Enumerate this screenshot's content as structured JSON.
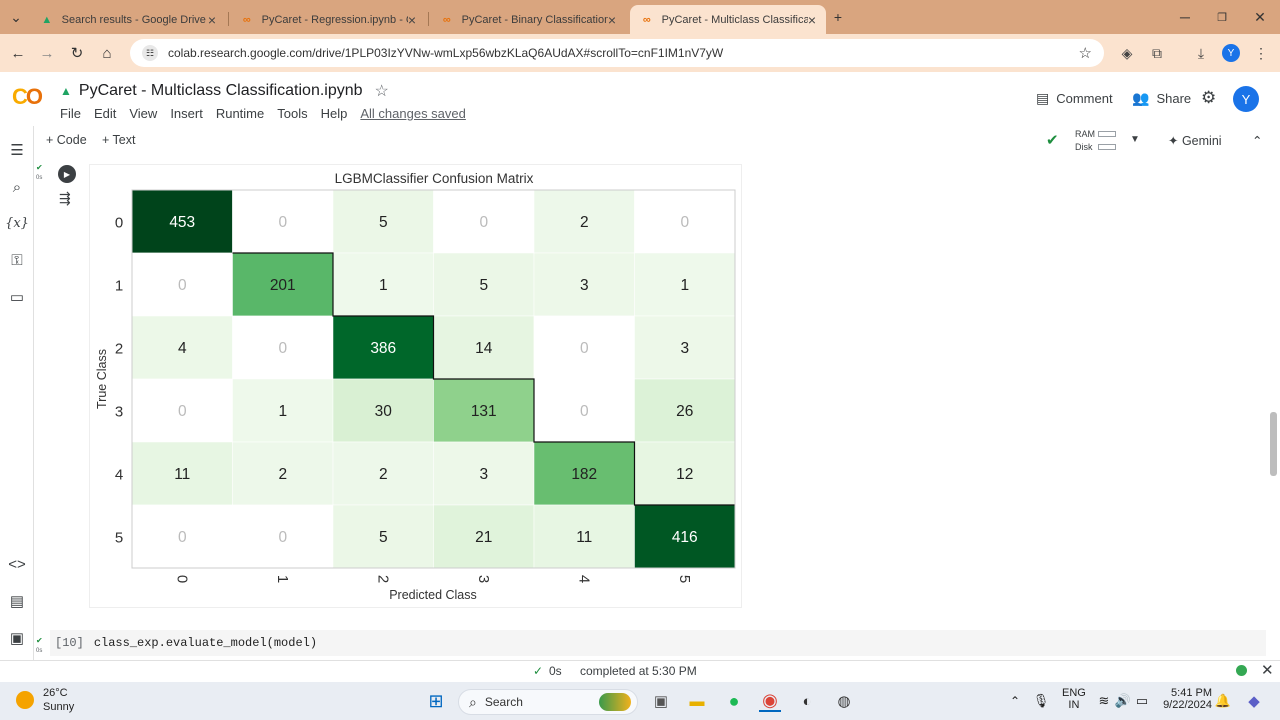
{
  "browser": {
    "tabs": [
      {
        "title": "Search results - Google Drive",
        "icon": "google-drive-icon"
      },
      {
        "title": "PyCaret - Regression.ipynb - Co",
        "icon": "colab-icon"
      },
      {
        "title": "PyCaret - Binary Classification.ip",
        "icon": "colab-icon"
      },
      {
        "title": "PyCaret - Multiclass Classificatio",
        "icon": "colab-icon",
        "active": true
      }
    ],
    "url": "colab.research.google.com/drive/1PLP03IzYVNw-wmLxp56wbzKLaQ6AUdAX#scrollTo=cnF1IM1nV7yW",
    "profile_initial": "Y"
  },
  "colab": {
    "notebook_title": "PyCaret - Multiclass Classification.ipynb",
    "menu": [
      "File",
      "Edit",
      "View",
      "Insert",
      "Runtime",
      "Tools",
      "Help"
    ],
    "saved_status": "All changes saved",
    "comment_label": "Comment",
    "share_label": "Share",
    "user_initial": "Y",
    "add_code": "+ Code",
    "add_text": "+ Text",
    "ram_label": "RAM",
    "disk_label": "Disk",
    "gemini_label": "Gemini",
    "exec_time": "0s"
  },
  "chart_data": {
    "type": "heatmap",
    "title": "LGBMClassifier Confusion Matrix",
    "xlabel": "Predicted Class",
    "ylabel": "True Class",
    "x_ticks": [
      "0",
      "1",
      "2",
      "3",
      "4",
      "5"
    ],
    "y_ticks": [
      "0",
      "1",
      "2",
      "3",
      "4",
      "5"
    ],
    "matrix": [
      [
        453,
        0,
        5,
        0,
        2,
        0
      ],
      [
        0,
        201,
        1,
        5,
        3,
        1
      ],
      [
        4,
        0,
        386,
        14,
        0,
        3
      ],
      [
        0,
        1,
        30,
        131,
        0,
        26
      ],
      [
        11,
        2,
        2,
        3,
        182,
        12
      ],
      [
        0,
        0,
        5,
        21,
        11,
        416
      ]
    ],
    "colormap": "Greens"
  },
  "code_cell": {
    "exec_count": "[10]",
    "code": "class_exp.evaluate_model(model)"
  },
  "status": {
    "time": "0s",
    "completed": "completed at 5:30 PM"
  },
  "taskbar": {
    "temp": "26°C",
    "weather": "Sunny",
    "search": "Search",
    "lang1": "ENG",
    "lang2": "IN",
    "time": "5:41 PM",
    "date": "9/22/2024"
  }
}
